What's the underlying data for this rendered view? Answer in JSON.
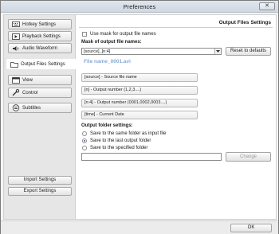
{
  "window": {
    "title": "Preferences",
    "close_glyph": "✕"
  },
  "sidebar": {
    "items": [
      {
        "label": "Hotkey Settings",
        "icon": "keyboard-icon"
      },
      {
        "label": "Playback Settings",
        "icon": "playback-icon"
      },
      {
        "label": "Audio Waveform",
        "icon": "speaker-icon"
      },
      {
        "label": "Output Files Settings",
        "icon": "folder-icon",
        "active": true
      },
      {
        "label": "View",
        "icon": "view-icon"
      },
      {
        "label": "Control",
        "icon": "wrench-icon"
      },
      {
        "label": "Subtitles",
        "icon": "subtitles-icon"
      }
    ],
    "import_label": "Import Settings",
    "export_label": "Export Settings"
  },
  "panel": {
    "title": "Output Files Settings",
    "use_mask_label": "Use mask for output file names",
    "use_mask_checked": false,
    "mask_heading": "Mask of output file names:",
    "mask_value": "[source]_[n:4]",
    "reset_label": "Reset to defaults",
    "preview": "File name_0001.avi",
    "tokens": [
      "[source] - Source file name",
      "[n] - Output number (1,2,3....)",
      "[n:4] - Output number (0001,0002,0003....)",
      "[time] - Current Date"
    ],
    "folder_heading": "Output folder settings:",
    "folder_options": [
      {
        "label": "Save to the same folder as input file",
        "selected": false
      },
      {
        "label": "Save to the last output folder",
        "selected": true
      },
      {
        "label": "Save to the specified folder",
        "selected": false
      }
    ],
    "folder_path": "",
    "change_label": "Change"
  },
  "footer": {
    "ok_label": "OK"
  }
}
